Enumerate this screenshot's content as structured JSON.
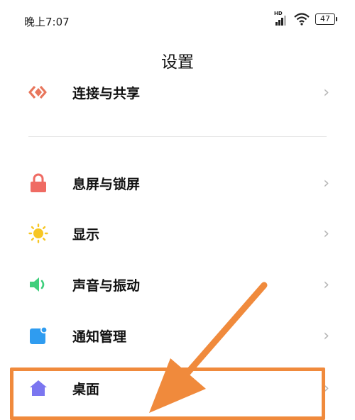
{
  "status_bar": {
    "time": "晚上7:07",
    "network_label": "HD",
    "battery": "47",
    "icons": [
      "hd-signal-icon",
      "wifi-icon",
      "battery-icon"
    ]
  },
  "header": {
    "title": "设置"
  },
  "settings": {
    "items": [
      {
        "label": "连接与共享",
        "icon": "share-icon",
        "color": "#e8765c"
      },
      {
        "label": "息屏与锁屏",
        "icon": "lock-icon",
        "color": "#ef6b63"
      },
      {
        "label": "显示",
        "icon": "sun-icon",
        "color": "#f7c623"
      },
      {
        "label": "声音与振动",
        "icon": "speaker-icon",
        "color": "#3fcf7c"
      },
      {
        "label": "通知管理",
        "icon": "notification-icon",
        "color": "#2f9cf0"
      },
      {
        "label": "桌面",
        "icon": "home-icon",
        "color": "#7b76f0"
      }
    ]
  },
  "annotation": {
    "highlight_color": "#f08a3c",
    "target": "桌面"
  }
}
